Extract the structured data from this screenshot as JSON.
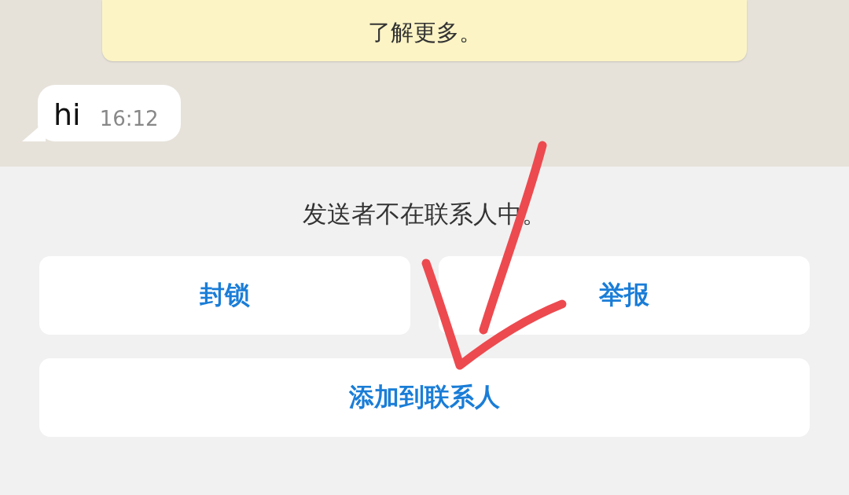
{
  "banner": {
    "text": "了解更多。"
  },
  "message": {
    "text": "hi",
    "time": "16:12"
  },
  "sheet": {
    "notice": "发送者不在联系人中。",
    "buttons": [
      {
        "label": "封锁"
      },
      {
        "label": "举报"
      },
      {
        "label": "添加到联系人"
      }
    ]
  }
}
